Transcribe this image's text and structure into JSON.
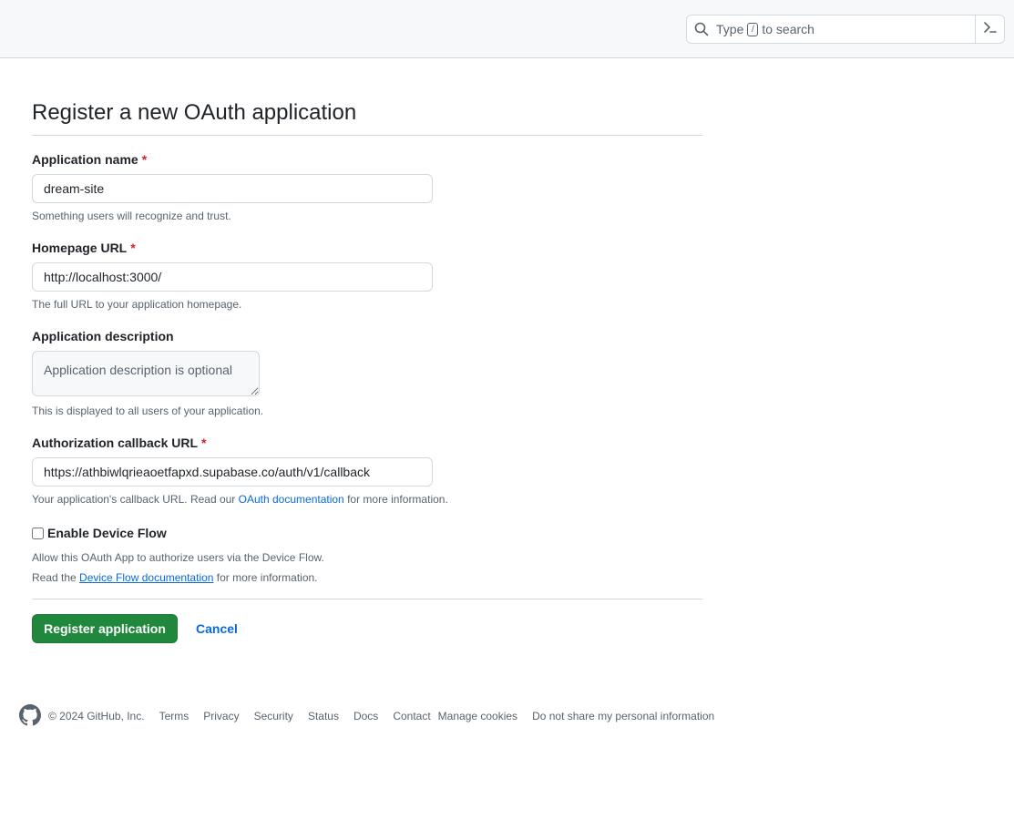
{
  "header": {
    "search": {
      "prefix": "Type",
      "key": "/",
      "suffix": "to search"
    }
  },
  "page": {
    "title": "Register a new OAuth application"
  },
  "form": {
    "app_name": {
      "label": "Application name",
      "required_mark": "*",
      "value": "dream-site",
      "note": "Something users will recognize and trust."
    },
    "homepage_url": {
      "label": "Homepage URL",
      "required_mark": "*",
      "value": "http://localhost:3000/",
      "note": "The full URL to your application homepage."
    },
    "description": {
      "label": "Application description",
      "placeholder": "Application description is optional",
      "note": "This is displayed to all users of your application."
    },
    "callback_url": {
      "label": "Authorization callback URL",
      "required_mark": "*",
      "value": "https://athbiwlqrieaoetfapxd.supabase.co/auth/v1/callback",
      "note_prefix": "Your application's callback URL. Read our",
      "note_link": "OAuth documentation",
      "note_suffix": "for more information."
    },
    "device_flow": {
      "label": "Enable Device Flow",
      "checked": false,
      "note1": "Allow this OAuth App to authorize users via the Device Flow.",
      "note2_prefix": "Read the",
      "note2_link": "Device Flow documentation",
      "note2_suffix": "for more information."
    },
    "submit_label": "Register application",
    "cancel_label": "Cancel"
  },
  "footer": {
    "copyright": "© 2024 GitHub, Inc.",
    "links": [
      "Terms",
      "Privacy",
      "Security",
      "Status",
      "Docs",
      "Contact",
      "Manage cookies",
      "Do not share my personal information"
    ]
  },
  "colors": {
    "primary_button": "#1f883d",
    "link": "#0969da",
    "required": "#d1242f"
  },
  "icons": [
    "search-icon",
    "command-palette-icon",
    "github-logo-icon"
  ]
}
